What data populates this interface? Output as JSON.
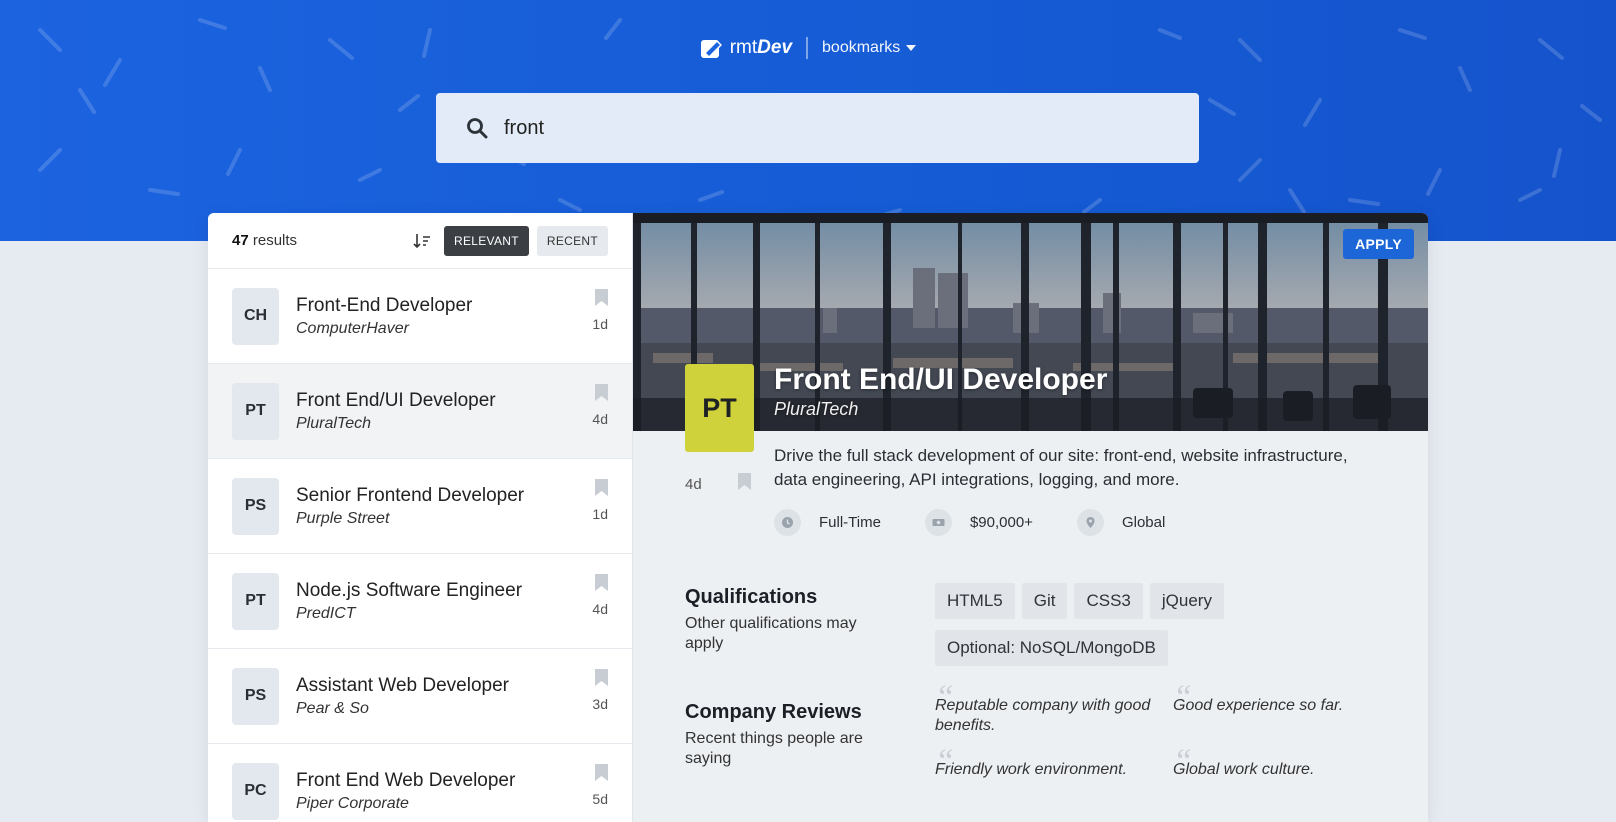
{
  "header": {
    "brand_prefix": "rmt",
    "brand_suffix": "Dev",
    "bookmarks_label": "bookmarks",
    "logo_icon": "rmtdev-logo-icon",
    "dropdown_icon": "caret-down-icon"
  },
  "search": {
    "value": "front",
    "icon": "search-icon"
  },
  "sidebar": {
    "results_count": "47",
    "results_label": " results",
    "sort_relevant_label": "RELEVANT",
    "sort_recent_label": "RECENT",
    "jobs": [
      {
        "badge": "CH",
        "title": "Front-End Developer",
        "company": "ComputerHaver",
        "age": "1d",
        "selected": false
      },
      {
        "badge": "PT",
        "title": "Front End/UI Developer",
        "company": "PluralTech",
        "age": "4d",
        "selected": true
      },
      {
        "badge": "PS",
        "title": "Senior Frontend Developer",
        "company": "Purple Street",
        "age": "1d",
        "selected": false
      },
      {
        "badge": "PT",
        "title": "Node.js Software Engineer",
        "company": "PredICT",
        "age": "4d",
        "selected": false
      },
      {
        "badge": "PS",
        "title": "Assistant Web Developer",
        "company": "Pear & So",
        "age": "3d",
        "selected": false
      },
      {
        "badge": "PC",
        "title": "Front End Web Developer",
        "company": "Piper Corporate",
        "age": "5d",
        "selected": false
      }
    ]
  },
  "detail": {
    "apply_label": "APPLY",
    "badge": "PT",
    "badge_color": "#cfd23a",
    "title": "Front End/UI Developer",
    "company": "PluralTech",
    "age": "4d",
    "description": "Drive the full stack development of our site: front-end, website infrastructure, data engineering, API integrations, logging, and more.",
    "tags": {
      "duration": "Full-Time",
      "salary": "$90,000+",
      "location": "Global"
    },
    "qualifications": {
      "title": "Qualifications",
      "subtitle": "Other qualifications may apply",
      "items": [
        "HTML5",
        "Git",
        "CSS3",
        "jQuery",
        "Optional: NoSQL/MongoDB"
      ]
    },
    "reviews": {
      "title": "Company Reviews",
      "subtitle": "Recent things people are saying",
      "items": [
        "Reputable company with good benefits.",
        "Good experience so far.",
        "Friendly work environment.",
        "Global work culture."
      ]
    }
  },
  "colors": {
    "header_bg": "#1c63e0",
    "active_sort": "#3b3f44",
    "apply": "#1c66d8"
  }
}
